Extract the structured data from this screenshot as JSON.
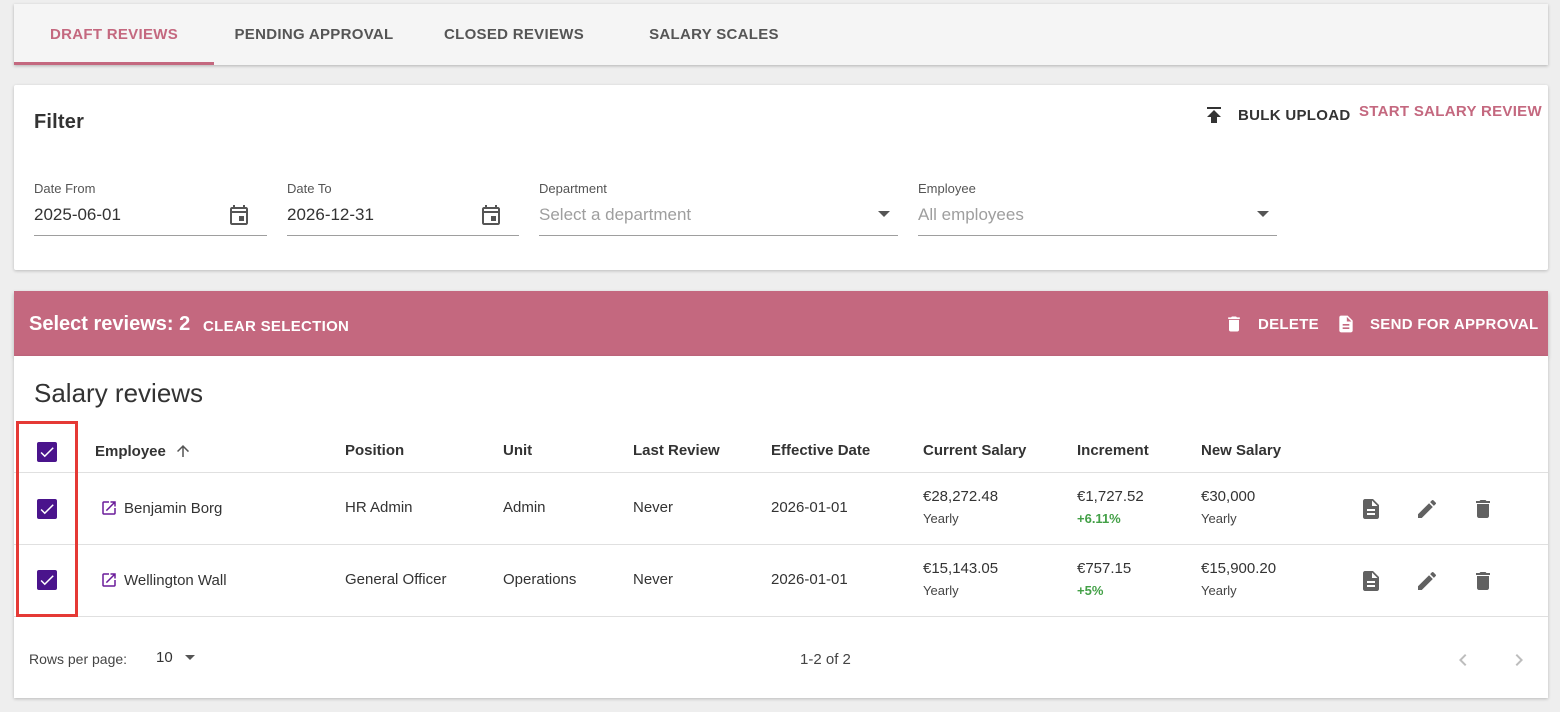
{
  "tabs": [
    {
      "label": "DRAFT REVIEWS"
    },
    {
      "label": "PENDING APPROVAL"
    },
    {
      "label": "CLOSED REVIEWS"
    },
    {
      "label": "SALARY SCALES"
    }
  ],
  "filter": {
    "title": "Filter",
    "bulk_upload": "BULK UPLOAD",
    "start_review": "START SALARY REVIEW",
    "date_from": {
      "label": "Date From",
      "value": "2025-06-01"
    },
    "date_to": {
      "label": "Date To",
      "value": "2026-12-31"
    },
    "department": {
      "label": "Department",
      "placeholder": "Select a department"
    },
    "employee": {
      "label": "Employee",
      "placeholder": "All employees"
    }
  },
  "selection_bar": {
    "title": "Select reviews: 2",
    "clear": "CLEAR SELECTION",
    "delete": "DELETE",
    "send": "SEND FOR APPROVAL",
    "color": "#c4687f"
  },
  "table": {
    "title": "Salary reviews",
    "columns": [
      "Employee",
      "Position",
      "Unit",
      "Last Review",
      "Effective Date",
      "Current Salary",
      "Increment",
      "New Salary"
    ],
    "rows": [
      {
        "employee": "Benjamin Borg",
        "position": "HR Admin",
        "unit": "Admin",
        "last_review": "Never",
        "effective_date": "2026-01-01",
        "current_salary": "€28,272.48",
        "current_period": "Yearly",
        "increment": "€1,727.52",
        "increment_pct": "+6.11%",
        "new_salary": "€30,000",
        "new_period": "Yearly",
        "checked": true
      },
      {
        "employee": "Wellington Wall",
        "position": "General Officer",
        "unit": "Operations",
        "last_review": "Never",
        "effective_date": "2026-01-01",
        "current_salary": "€15,143.05",
        "current_period": "Yearly",
        "increment": "€757.15",
        "increment_pct": "+5%",
        "new_salary": "€15,900.20",
        "new_period": "Yearly",
        "checked": true
      }
    ],
    "footer": {
      "rows_per_page_label": "Rows per page:",
      "rows_per_page": "10",
      "page_info": "1-2 of 2"
    }
  },
  "icons": {
    "upload": "upload-icon",
    "calendar": "calendar-icon",
    "trash": "trash-icon",
    "document": "document-icon",
    "pencil": "pencil-icon",
    "open": "open-in-new-icon",
    "sort": "arrow-up-icon"
  }
}
